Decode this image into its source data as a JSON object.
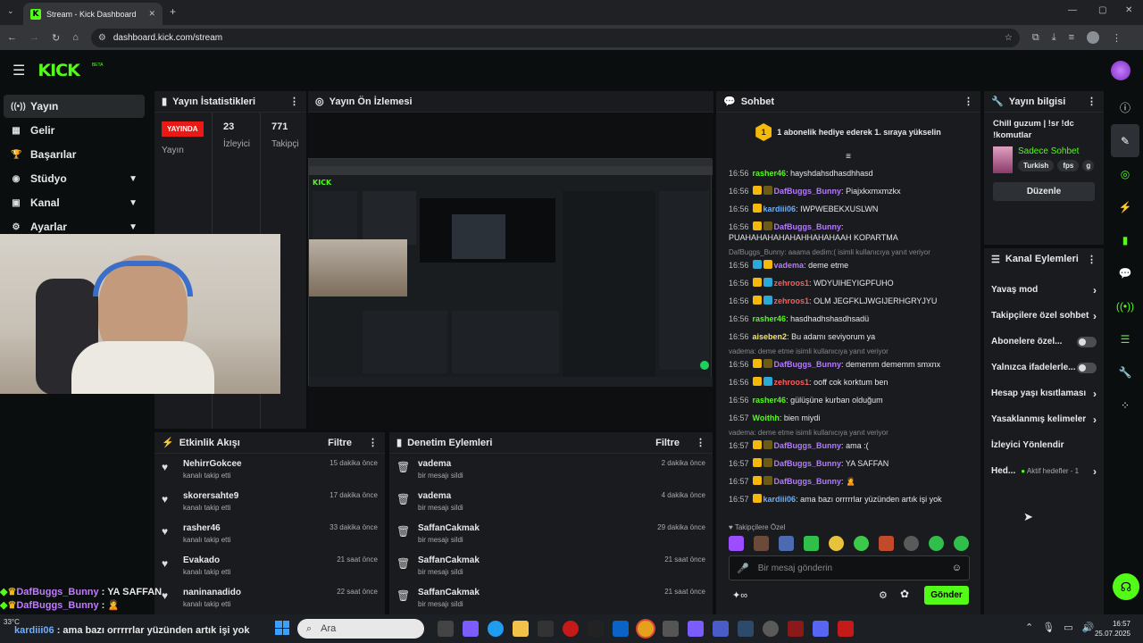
{
  "browser": {
    "tab_title": "Stream - Kick Dashboard",
    "url": "dashboard.kick.com/stream"
  },
  "app": {
    "logo": "KICK",
    "logo_badge": "BETA"
  },
  "sidebar": {
    "items": [
      {
        "label": "Yayın",
        "icon": "broadcast-icon",
        "active": true
      },
      {
        "label": "Gelir",
        "icon": "grid-icon"
      },
      {
        "label": "Başarılar",
        "icon": "trophy-icon"
      },
      {
        "label": "Stüdyo",
        "icon": "studio-icon",
        "expandable": true
      },
      {
        "label": "Kanal",
        "icon": "channel-icon",
        "expandable": true
      },
      {
        "label": "Ayarlar",
        "icon": "gear-icon",
        "expandable": true
      }
    ]
  },
  "stats": {
    "title": "Yayın İstatistikleri",
    "live_badge": "YAYINDA",
    "live_label": "Yayın",
    "viewers_value": "23",
    "viewers_label": "İzleyici",
    "followers_value": "771",
    "followers_label": "Takipçi"
  },
  "preview": {
    "title": "Yayın Ön İzlemesi"
  },
  "activity": {
    "title": "Etkinlik Akışı",
    "filter": "Filtre",
    "items": [
      {
        "name": "NehirrGokcee",
        "action": "kanalı takip etti",
        "time": "15 dakika önce"
      },
      {
        "name": "skorersahte9",
        "action": "kanalı takip etti",
        "time": "17 dakika önce"
      },
      {
        "name": "rasher46",
        "action": "kanalı takip etti",
        "time": "33 dakika önce"
      },
      {
        "name": "Evakado",
        "action": "kanalı takip etti",
        "time": "21 saat önce"
      },
      {
        "name": "naninanadido",
        "action": "kanalı takip etti",
        "time": "22 saat önce"
      }
    ]
  },
  "moderation": {
    "title": "Denetim Eylemleri",
    "filter": "Filtre",
    "items": [
      {
        "name": "vadema",
        "action": "bir mesajı sildi",
        "time": "2 dakika önce"
      },
      {
        "name": "vadema",
        "action": "bir mesajı sildi",
        "time": "4 dakika önce"
      },
      {
        "name": "SaffanCakmak",
        "action": "bir mesajı sildi",
        "time": "29 dakika önce"
      },
      {
        "name": "SaffanCakmak",
        "action": "bir mesajı sildi",
        "time": "21 saat önce"
      },
      {
        "name": "SaffanCakmak",
        "action": "bir mesajı sildi",
        "time": "21 saat önce"
      }
    ]
  },
  "chat": {
    "title": "Sohbet",
    "pinned_rank": "1",
    "pinned_text": "1 abonelik hediye ederek 1. sıraya yükselin",
    "messages": [
      {
        "time": "16:56",
        "user": "rasher46",
        "color": "#53fc18",
        "badges": "",
        "text": "hayshdahsdhasdhhasd"
      },
      {
        "time": "16:56",
        "user": "DafBuggs_Bunny",
        "color": "#b57aff",
        "badges": "ps",
        "text": "Piajxkxmxmzkx"
      },
      {
        "time": "16:56",
        "user": "kardiii06",
        "color": "#6ab0ff",
        "badges": "p",
        "text": "IWPWEBEKXUSLWN"
      },
      {
        "time": "16:56",
        "user": "DafBuggs_Bunny",
        "color": "#b57aff",
        "badges": "ps",
        "text": "PUAHAHAHAHAHAHHAHAHAAH KOPARTMA"
      },
      {
        "reply": "DafBuggs_Bunny: aaama dedim:( isimli kullanıcıya yanıt veriyor",
        "time": "16:56",
        "user": "vadema",
        "color": "#b57aff",
        "badges": "cp",
        "text": "deme etme"
      },
      {
        "time": "16:56",
        "user": "zehroos1",
        "color": "#ff5b5b",
        "badges": "pc",
        "text": "WDYUIHEYIGPFUHO"
      },
      {
        "time": "16:56",
        "user": "zehroos1",
        "color": "#ff5b5b",
        "badges": "pc",
        "text": "OLM JEGFKLJWGIJERHGRYJYU"
      },
      {
        "time": "16:56",
        "user": "rasher46",
        "color": "#53fc18",
        "badges": "",
        "text": "hasdhadhshasdhsadü"
      },
      {
        "time": "16:56",
        "user": "aiseben2",
        "color": "#f5e663",
        "badges": "",
        "text": "Bu adamı seviyorum ya"
      },
      {
        "reply": "vadema: deme etme isimli kullanıcıya yanıt veriyor",
        "time": "16:56",
        "user": "DafBuggs_Bunny",
        "color": "#b57aff",
        "badges": "ps",
        "text": "dememm dememm smxnx"
      },
      {
        "time": "16:56",
        "user": "zehroos1",
        "color": "#ff5b5b",
        "badges": "pc",
        "text": "ooff cok korktum ben"
      },
      {
        "time": "16:56",
        "user": "rasher46",
        "color": "#53fc18",
        "badges": "",
        "text": "gülüşüne kurban olduğum"
      },
      {
        "time": "16:57",
        "user": "Woithh",
        "color": "#53fc18",
        "badges": "",
        "text": "bien miydi"
      },
      {
        "reply": "vadema: deme etme isimli kullanıcıya yanıt veriyor",
        "time": "16:57",
        "user": "DafBuggs_Bunny",
        "color": "#b57aff",
        "badges": "ps",
        "text": "ama :("
      },
      {
        "time": "16:57",
        "user": "DafBuggs_Bunny",
        "color": "#b57aff",
        "badges": "ps",
        "text": "YA SAFFAN"
      },
      {
        "time": "16:57",
        "user": "DafBuggs_Bunny",
        "color": "#b57aff",
        "badges": "ps",
        "text": "🙎"
      },
      {
        "time": "16:57",
        "user": "kardiii06",
        "color": "#6ab0ff",
        "badges": "p",
        "text": "ama bazı orrrrrlar yüzünden artık işi yok"
      }
    ],
    "emote_label": "Takipçilere Özel",
    "input_placeholder": "Bir mesaj gönderin",
    "send_label": "Gönder"
  },
  "stream_info": {
    "title": "Yayın bilgisi",
    "stream_title": "Chill guzum | !sr !dc !komutlar",
    "category": "Sadece Sohbet",
    "tags": [
      "Turkish",
      "fps",
      "g"
    ],
    "edit_label": "Düzenle"
  },
  "channel_actions": {
    "title": "Kanal Eylemleri",
    "items": [
      {
        "label": "Yavaş mod",
        "kind": "arrow"
      },
      {
        "label": "Takipçilere özel sohbet",
        "kind": "arrow"
      },
      {
        "label": "Abonelere özel...",
        "kind": "toggle"
      },
      {
        "label": "Yalnızca ifadelerle...",
        "kind": "toggle"
      },
      {
        "label": "Hesap yaşı kısıtlaması",
        "kind": "arrow"
      },
      {
        "label": "Yasaklanmış kelimeler",
        "kind": "arrow"
      },
      {
        "label": "İzleyici Yönlendir",
        "kind": "none"
      },
      {
        "label": "Hed...",
        "kind": "goal",
        "extra": "Aktif hedefler - 1"
      }
    ]
  },
  "overlay": {
    "lines": [
      {
        "user": "DafBuggs_Bunny",
        "text": "YA SAFFAN"
      },
      {
        "user": "DafBuggs_Bunny",
        "text": "🙎"
      },
      {
        "user": "kardiii06",
        "text": "ama bazı orrrrrlar yüzünden artık işi yok"
      }
    ],
    "weather": "33°C"
  },
  "taskbar": {
    "search_placeholder": "Ara",
    "time": "16:57",
    "date": "25.07.2025"
  },
  "colors": {
    "accent": "#53fc18",
    "live": "#e91916",
    "panel": "#191b1f"
  }
}
